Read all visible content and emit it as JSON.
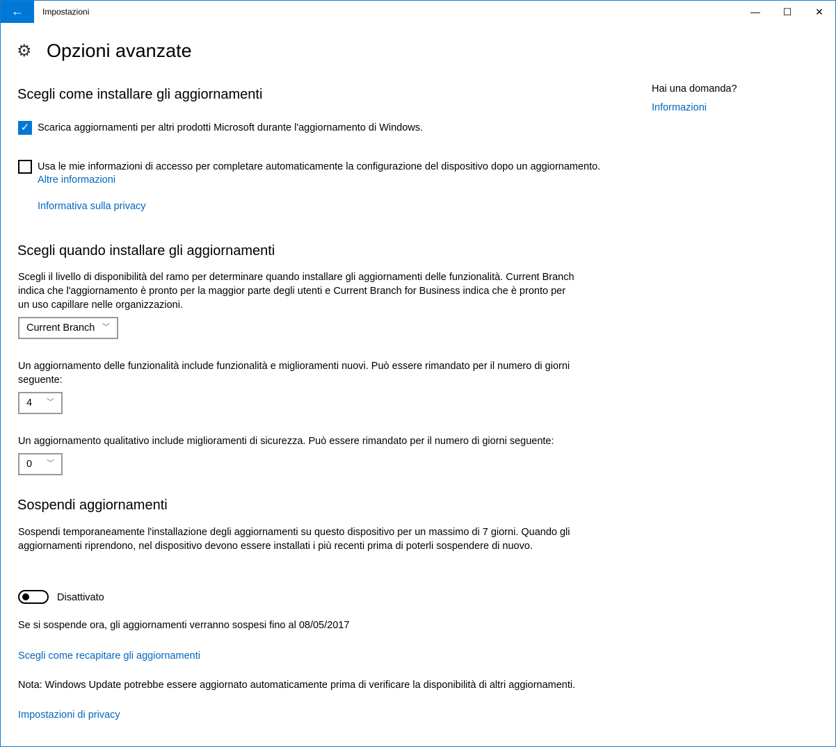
{
  "window": {
    "title": "Impostazioni",
    "minimize": "—",
    "maximize": "☐",
    "close": "✕"
  },
  "header": {
    "title": "Opzioni avanzate",
    "icon": "gear-icon"
  },
  "side": {
    "question": "Hai una domanda?",
    "link": "Informazioni"
  },
  "install": {
    "heading": "Scegli come installare gli aggiornamenti",
    "checkbox1": {
      "label": "Scarica aggiornamenti per altri prodotti Microsoft durante l'aggiornamento di Windows.",
      "checked": true
    },
    "checkbox2": {
      "label": "Usa le mie informazioni di accesso per completare automaticamente la configurazione del dispositivo dopo un aggiornamento.",
      "checked": false
    },
    "more_info": "Altre informazioni",
    "privacy": "Informativa sulla privacy"
  },
  "when": {
    "heading": "Scegli quando installare gli aggiornamenti",
    "desc": "Scegli il livello di disponibilità del ramo per determinare quando installare gli aggiornamenti delle funzionalità. Current Branch indica che l'aggiornamento è pronto per la maggior parte degli utenti e Current Branch for Business indica che è pronto per un uso capillare nelle organizzazioni.",
    "branch": "Current Branch",
    "feature_desc": "Un aggiornamento delle funzionalità include funzionalità e miglioramenti nuovi. Può essere rimandato per il numero di giorni seguente:",
    "feature_days": "4",
    "quality_desc": "Un aggiornamento qualitativo include miglioramenti di sicurezza. Può essere rimandato per il numero di giorni seguente:",
    "quality_days": "0"
  },
  "pause": {
    "heading": "Sospendi aggiornamenti",
    "desc": "Sospendi temporaneamente l'installazione degli aggiornamenti su questo dispositivo per un massimo di 7 giorni. Quando gli aggiornamenti riprendono, nel dispositivo devono essere installati i più recenti prima di poterli sospendere di nuovo.",
    "toggle_state": "Disattivato",
    "toggle_on": false,
    "until": "Se si sospende ora, gli aggiornamenti verranno sospesi fino al 08/05/2017"
  },
  "delivery_link": "Scegli come recapitare gli aggiornamenti",
  "note": "Nota: Windows Update potrebbe essere aggiornato automaticamente prima di verificare la disponibilità di altri aggiornamenti.",
  "privacy_link": "Impostazioni di privacy"
}
